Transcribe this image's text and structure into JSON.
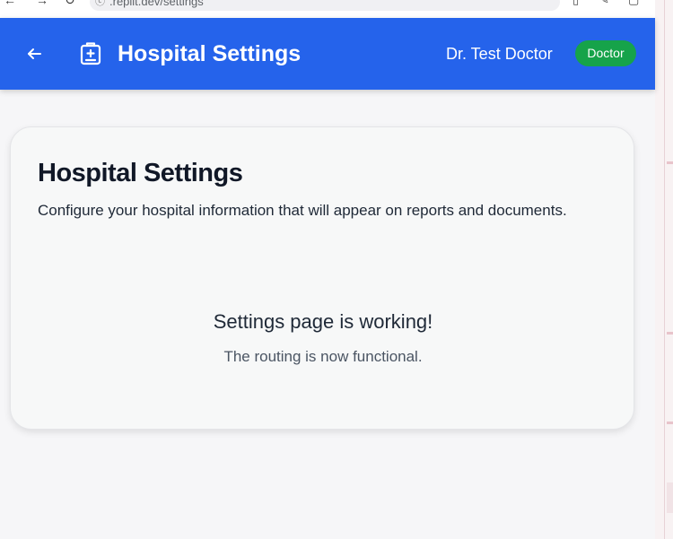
{
  "browser": {
    "url": ".replit.dev/settings",
    "nav_back_glyph": "←",
    "nav_forward_glyph": "→",
    "reload_glyph": "↻"
  },
  "header": {
    "title": "Hospital Settings",
    "user_name": "Dr. Test Doctor",
    "role_badge": "Doctor",
    "background_color": "#2563eb",
    "badge_color": "#16a34a",
    "back_icon": "arrow-left-icon",
    "logo_icon": "hospital-clipboard-icon"
  },
  "card": {
    "title": "Hospital Settings",
    "description": "Configure your hospital information that will appear on reports and documents.",
    "status_message": "Settings page is working!",
    "status_subtext": "The routing is now functional."
  }
}
